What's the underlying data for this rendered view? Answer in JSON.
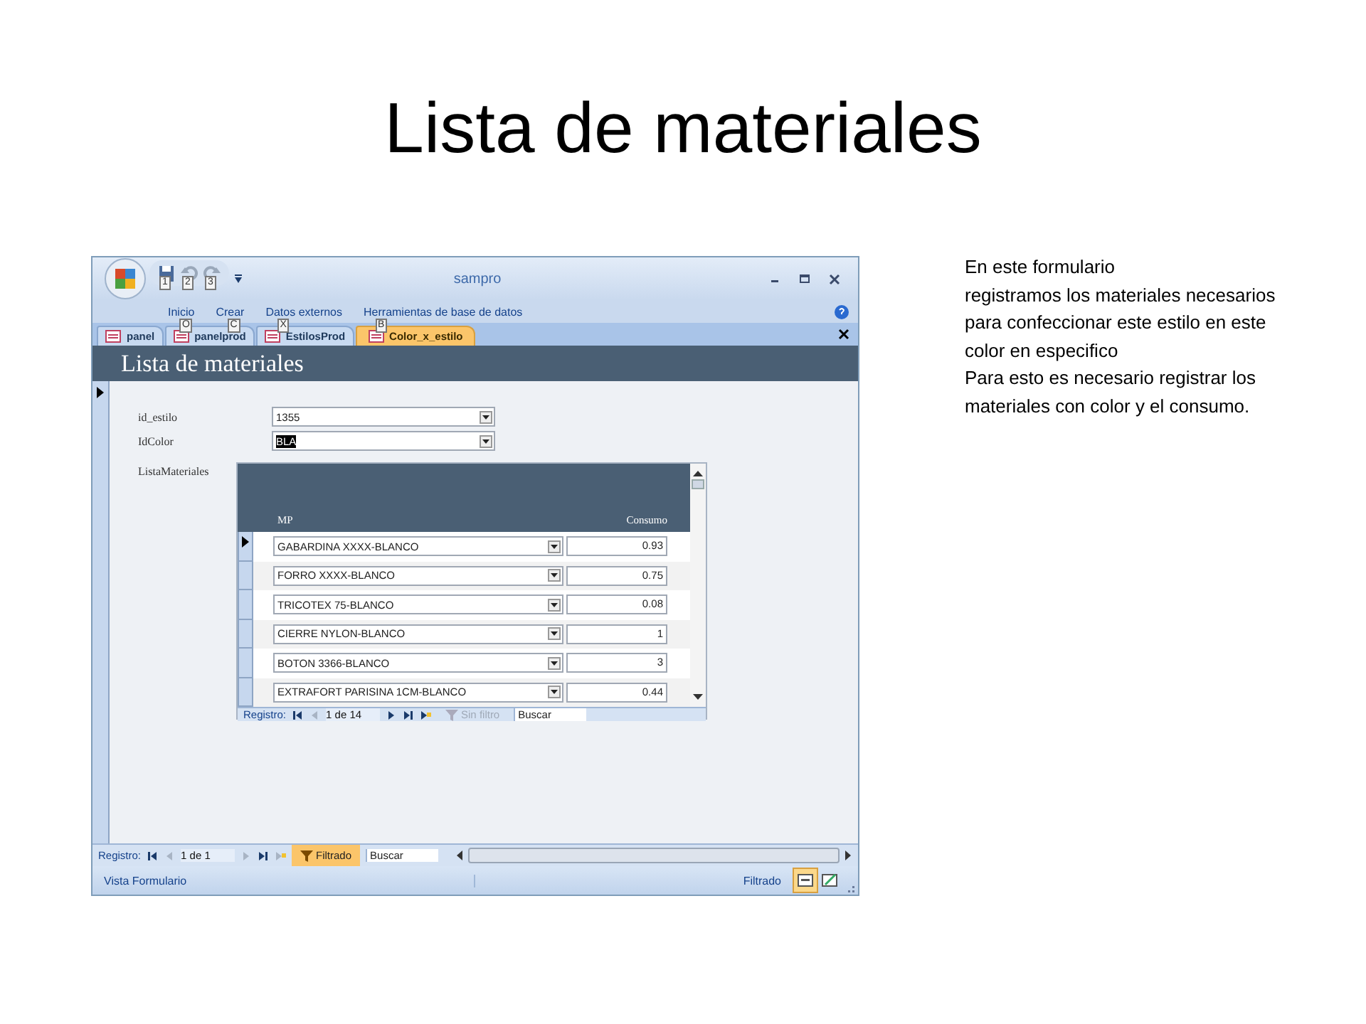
{
  "slide_title": "Lista de materiales",
  "window": {
    "title": "sampro",
    "quick_access_keytips": [
      "1",
      "2",
      "3"
    ]
  },
  "ribbon_tabs": [
    {
      "label": "Inicio",
      "keytip": "O"
    },
    {
      "label": "Crear",
      "keytip": "C"
    },
    {
      "label": "Datos externos",
      "keytip": "X"
    },
    {
      "label": "Herramientas de base de datos",
      "keytip": "B"
    }
  ],
  "doc_tabs": [
    {
      "label": "panel",
      "selected": false
    },
    {
      "label": "panelprod",
      "selected": false
    },
    {
      "label": "EstilosProd",
      "selected": false
    },
    {
      "label": "Color_x_estilo",
      "selected": true
    }
  ],
  "form": {
    "title": "Lista de materiales",
    "fields": [
      {
        "label": "id_estilo",
        "value": "1355",
        "highlighted": false
      },
      {
        "label": "IdColor",
        "value": "BLA",
        "highlighted": true
      }
    ],
    "subform": {
      "label": "ListaMateriales",
      "columns": [
        "MP",
        "Consumo"
      ],
      "rows": [
        {
          "mp": "GABARDINA XXXX-BLANCO",
          "consumo": "0.93",
          "current": true
        },
        {
          "mp": "FORRO XXXX-BLANCO",
          "consumo": "0.75",
          "current": false
        },
        {
          "mp": "TRICOTEX 75-BLANCO",
          "consumo": "0.08",
          "current": false
        },
        {
          "mp": "CIERRE NYLON-BLANCO",
          "consumo": "1",
          "current": false
        },
        {
          "mp": "BOTON 3366-BLANCO",
          "consumo": "3",
          "current": false
        },
        {
          "mp": "EXTRAFORT PARISINA 1CM-BLANCO",
          "consumo": "0.44",
          "current": false
        }
      ],
      "nav": {
        "label": "Registro:",
        "position": "1 de 14",
        "filter": "Sin filtro",
        "filtered": false,
        "search": "Buscar"
      }
    }
  },
  "nav": {
    "label": "Registro:",
    "position": "1 de 1",
    "filter": "Filtrado",
    "filtered": true,
    "search": "Buscar"
  },
  "status_bar": {
    "view": "Vista Formulario",
    "filter": "Filtrado",
    "view_buttons": [
      {
        "selected": true
      },
      {
        "selected": false
      }
    ]
  },
  "notes": [
    "En este formulario",
    "registramos los materiales necesarios",
    "para confeccionar este estilo en este",
    "color en especifico",
    "Para esto es necesario registrar los",
    "materiales con color y el consumo."
  ]
}
